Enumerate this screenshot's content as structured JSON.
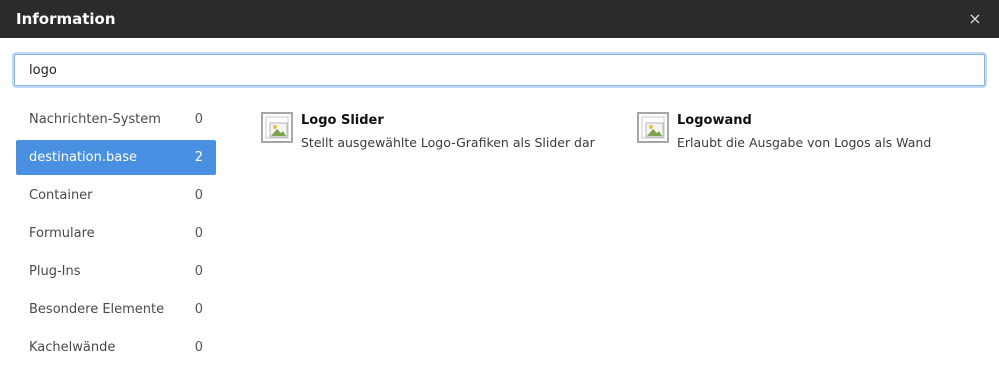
{
  "dialog": {
    "title": "Information",
    "close_symbol": "×"
  },
  "search": {
    "value": "logo",
    "placeholder": ""
  },
  "categories": [
    {
      "label": "Nachrichten-System",
      "count": "0"
    },
    {
      "label": "destination.base",
      "count": "2",
      "selected": true
    },
    {
      "label": "Container",
      "count": "0"
    },
    {
      "label": "Formulare",
      "count": "0"
    },
    {
      "label": "Plug-Ins",
      "count": "0"
    },
    {
      "label": "Besondere Elemente",
      "count": "0"
    },
    {
      "label": "Kachelwände",
      "count": "0"
    }
  ],
  "results": [
    {
      "title": "Logo Slider",
      "description": "Stellt ausgewählte Logo-Grafiken als Slider dar",
      "icon": "image-icon"
    },
    {
      "title": "Logowand",
      "description": "Erlaubt die Ausgabe von Logos als Wand",
      "icon": "image-icon"
    }
  ],
  "colors": {
    "titlebar": "#2b2b2b",
    "accent": "#4a90e2"
  }
}
